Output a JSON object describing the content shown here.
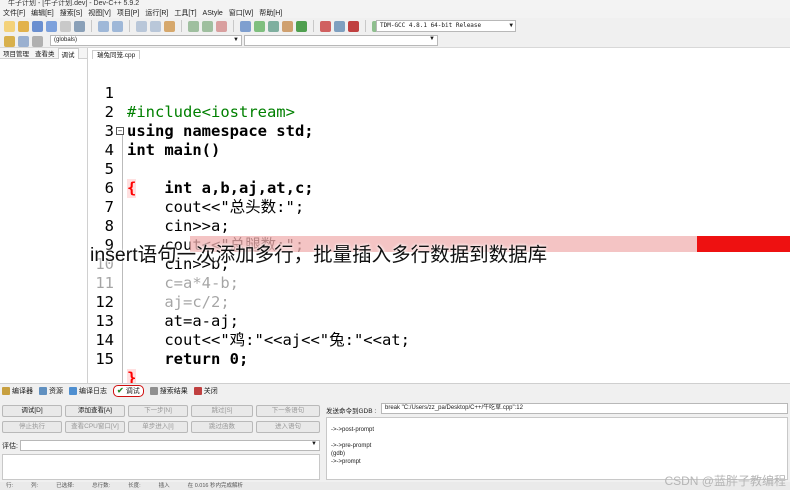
{
  "window": {
    "title": "牛子计划 - [牛子计划.dev] - Dev-C++ 5.9.2"
  },
  "menu": [
    "文件[F]",
    "编辑[E]",
    "搜索[S]",
    "视图[V]",
    "项目[P]",
    "运行[R]",
    "工具[T]",
    "AStyle",
    "窗口[W]",
    "帮助[H]"
  ],
  "toolbar": {
    "compiler": "TDM-GCC 4.8.1 64-bit Release"
  },
  "toolbar2": {
    "globals": "(globals)"
  },
  "left_panel": {
    "tabs": [
      "项目管理",
      "查看类",
      "调试"
    ],
    "active_tab": "调试"
  },
  "editor": {
    "file_tab": "瑞兔同笼.cpp",
    "lines": [
      {
        "n": "1",
        "text": "#include<iostream>"
      },
      {
        "n": "2",
        "text": "using namespace std;"
      },
      {
        "n": "3",
        "text": "int main()"
      },
      {
        "n": "4",
        "text": "{"
      },
      {
        "n": "5",
        "text": "    int a,b,aj,at,c;"
      },
      {
        "n": "6",
        "text": "    cout<<\"总头数:\";"
      },
      {
        "n": "7",
        "text": "    cin>>a;"
      },
      {
        "n": "8",
        "text": "    cout<<\"总腿数:\";"
      },
      {
        "n": "9",
        "text": "    cin>>b;"
      },
      {
        "n": "10",
        "text": "    c=a*4-b;"
      },
      {
        "n": "11",
        "text": "    aj=c/2;"
      },
      {
        "n": "12",
        "text": "    at=a-aj;"
      },
      {
        "n": "13",
        "text": "    cout<<\"鸡:\"<<aj<<\"兔:\"<<at;"
      },
      {
        "n": "14",
        "text": "    return 0;"
      },
      {
        "n": "15",
        "text": "}"
      }
    ]
  },
  "overlay": {
    "caption": "insert语句一次添加多行，批量插入多行数据到数据库",
    "highlight_color": "#ee1111"
  },
  "bottom_tabs": [
    {
      "label": "编译器",
      "icon": "compiler-icon"
    },
    {
      "label": "资源",
      "icon": "resources-icon"
    },
    {
      "label": "编译日志",
      "icon": "compile-log-icon"
    },
    {
      "label": "调试",
      "icon": "debug-check-icon",
      "active": true
    },
    {
      "label": "搜索结果",
      "icon": "search-results-icon"
    },
    {
      "label": "关闭",
      "icon": "close-icon"
    }
  ],
  "debug": {
    "buttons_row1": [
      "调试[D]",
      "添加查看[A]",
      "下一步[N]",
      "跳过[S]",
      "下一条语句"
    ],
    "buttons_row2": [
      "停止执行",
      "查看CPU窗口[V]",
      "单步进入[I]",
      "跳过函数",
      "进入语句"
    ],
    "eval_label": "评估:",
    "send_label": "发送命令到GDB :",
    "gdb_command": "break \"C:/Users/zz_pa/Desktop/C++/牛吃草.cpp\":12",
    "gdb_output": [
      "->->post-prompt",
      "",
      "->->pre-prompt",
      "(gdb)",
      "->->prompt"
    ]
  },
  "status": [
    "行:",
    "列:",
    "已选择:",
    "总行数:",
    "长度:",
    "插入",
    "在 0.016 秒内完成解析"
  ],
  "watermark": "CSDN @蓝胖子教编程"
}
